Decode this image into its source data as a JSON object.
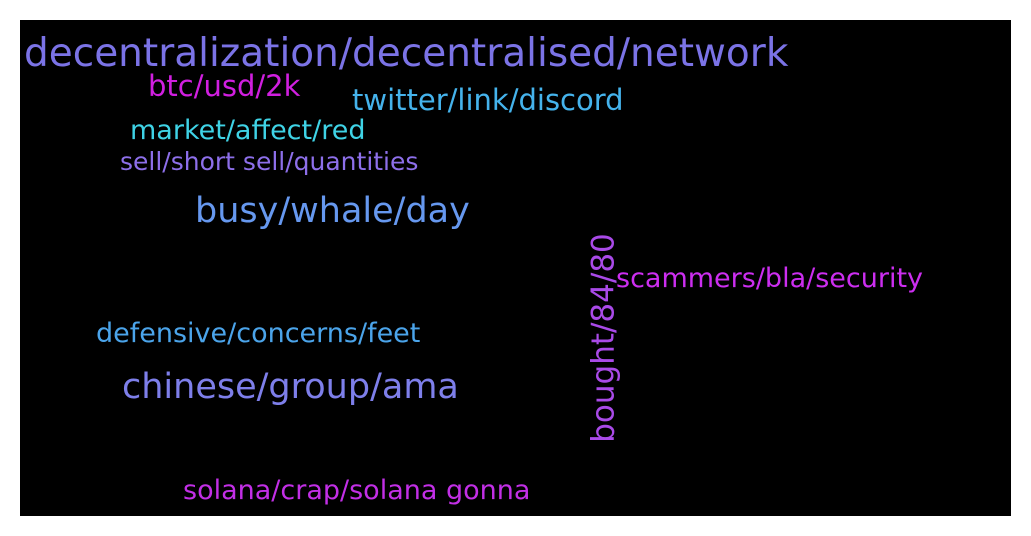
{
  "background_color": "#000000",
  "words": [
    {
      "text": "decentralization/decentralised/network",
      "color": "#7b73e6",
      "orientation": "horizontal"
    },
    {
      "text": "btc/usd/2k",
      "color": "#d11fe0",
      "orientation": "horizontal"
    },
    {
      "text": "twitter/link/discord",
      "color": "#45b3ec",
      "orientation": "horizontal"
    },
    {
      "text": "market/affect/red",
      "color": "#3fd3e6",
      "orientation": "horizontal"
    },
    {
      "text": "sell/short sell/quantities",
      "color": "#8d6fea",
      "orientation": "horizontal"
    },
    {
      "text": "busy/whale/day",
      "color": "#6698ef",
      "orientation": "horizontal"
    },
    {
      "text": "scammers/bla/security",
      "color": "#cc2ef0",
      "orientation": "horizontal"
    },
    {
      "text": "defensive/concerns/feet",
      "color": "#4ba4ea",
      "orientation": "horizontal"
    },
    {
      "text": "chinese/group/ama",
      "color": "#7e7fea",
      "orientation": "horizontal"
    },
    {
      "text": "solana/crap/solana gonna",
      "color": "#c22fe6",
      "orientation": "horizontal"
    },
    {
      "text": "bought/84/80",
      "color": "#a94ae8",
      "orientation": "vertical"
    }
  ]
}
